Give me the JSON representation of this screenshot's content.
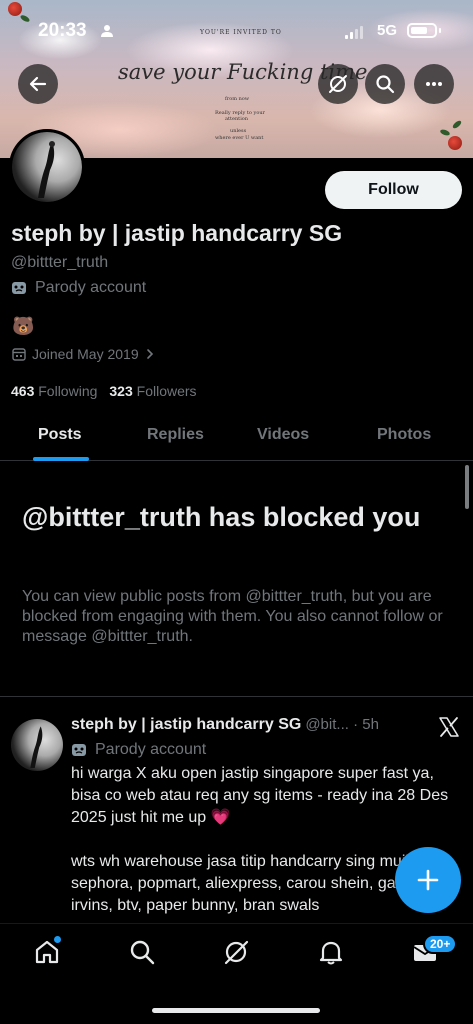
{
  "status_bar": {
    "time": "20:33",
    "network": "5G"
  },
  "banner": {
    "small_text": "YOU'RE INVITED TO",
    "script_text": "save your Fucking time",
    "lines": [
      "from now",
      "Really reply to your",
      "attention",
      "unless",
      "where ever U want"
    ]
  },
  "profile": {
    "follow_label": "Follow",
    "display_name": "steph by | jastip handcarry SG",
    "handle": "@bittter_truth",
    "parody_label": "Parody account",
    "bio_emoji": "🐻",
    "joined": "Joined May 2019",
    "following_count": "463",
    "following_label": "Following",
    "followers_count": "323",
    "followers_label": "Followers"
  },
  "tabs": [
    "Posts",
    "Replies",
    "Videos",
    "Photos"
  ],
  "blocked": {
    "title": "@bittter_truth has blocked you",
    "description": "You can view public posts from @bittter_truth, but you are blocked from engaging with them. You also cannot follow or message @bittter_truth."
  },
  "post": {
    "name": "steph by | jastip handcarry SG",
    "handle_time": "@bit... · 5h",
    "parody_label": "Parody account",
    "paragraph1": "hi warga X aku open jastip singapore super fast ya, bisa co web atau req any sg items - ready ina 28 Des 2025 just hit me up 💗",
    "paragraph2": "wts wh warehouse jasa titip handcarry sing muji, sephora, popmart, aliexpress, carou shein, garrett, irvins, btv, paper bunny, bran swals"
  },
  "bottom_nav": {
    "messages_badge": "20+"
  },
  "icons": [
    "back-arrow-icon",
    "grok-icon",
    "search-icon",
    "more-icon",
    "calendar-icon",
    "chevron-right-icon",
    "mask-icon",
    "x-logo-icon",
    "plus-icon",
    "home-icon",
    "bell-icon",
    "mail-icon"
  ],
  "colors": {
    "accent": "#1d9bf0",
    "text": "#e7e9ea",
    "muted": "#71767b",
    "background": "#000000"
  }
}
